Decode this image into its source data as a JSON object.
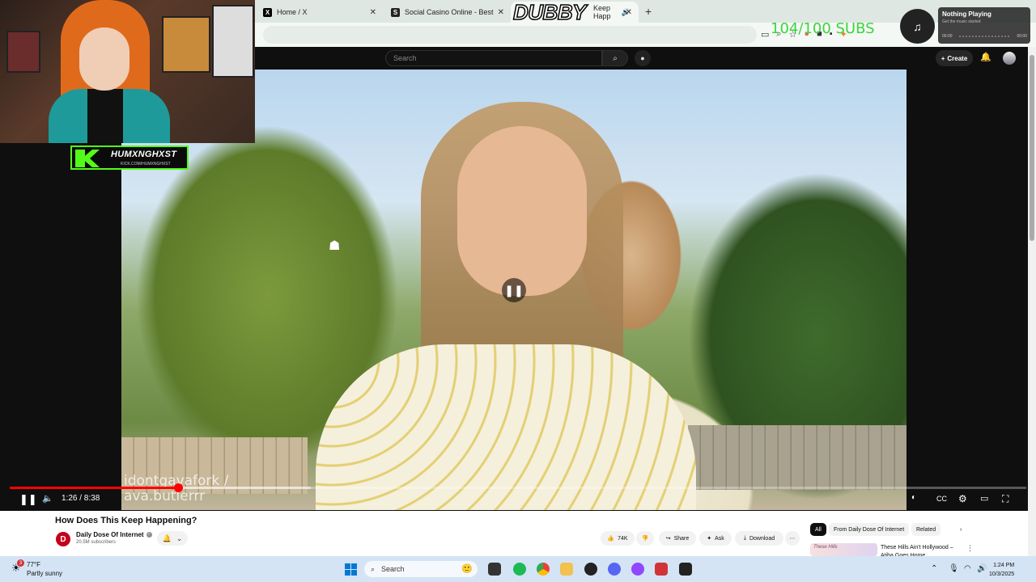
{
  "browser": {
    "tabs": [
      {
        "favicon": "X",
        "title": "Home / X"
      },
      {
        "favicon": "S",
        "title": "Social Casino Online - Best Soc"
      },
      {
        "favicon": "",
        "title": "Keep Happ"
      }
    ],
    "new_tab": "+"
  },
  "youtube": {
    "search_placeholder": "Search",
    "create_label": "Create"
  },
  "video": {
    "watermark_line1": "idontgavafork /",
    "watermark_line2": "ava.butlerrr",
    "time_display": "1:26 / 8:38",
    "progress_fraction": 0.166,
    "buffered_fraction": 0.296,
    "title": "How Does This Keep Happening?"
  },
  "channel": {
    "name": "Daily Dose Of Internet",
    "subscribers": "20.5M subscribers"
  },
  "actions": {
    "likes": "74K",
    "share": "Share",
    "ask": "Ask",
    "download": "Download"
  },
  "chips": [
    "All",
    "From Daily Dose Of Internet",
    "Related"
  ],
  "recommendation": {
    "thumb_text": "These Hills",
    "title": "These Hills Ain't Hollywood – Atiba Goes Home"
  },
  "taskbar": {
    "weather_badge": "3",
    "temperature": "77°F",
    "condition": "Partly sunny",
    "search_label": "Search",
    "time": "1:24 PM",
    "date": "10/3/2025"
  },
  "overlay": {
    "streamer_name": "HUMXNGHXST",
    "streamer_url": "KICK.COM/HUMXNGHXST",
    "dubby": "DUBBY",
    "sub_goal": "104/100 SUBS",
    "music_title": "Nothing Playing",
    "music_subtitle": "Get the music started",
    "music_time_start": "00:00",
    "music_time_end": "00:00"
  },
  "colors": {
    "youtube_red": "#ff0000",
    "kick_green": "#53fc18",
    "sub_goal_green": "#3dd43d",
    "channel_red": "#c4001a"
  }
}
